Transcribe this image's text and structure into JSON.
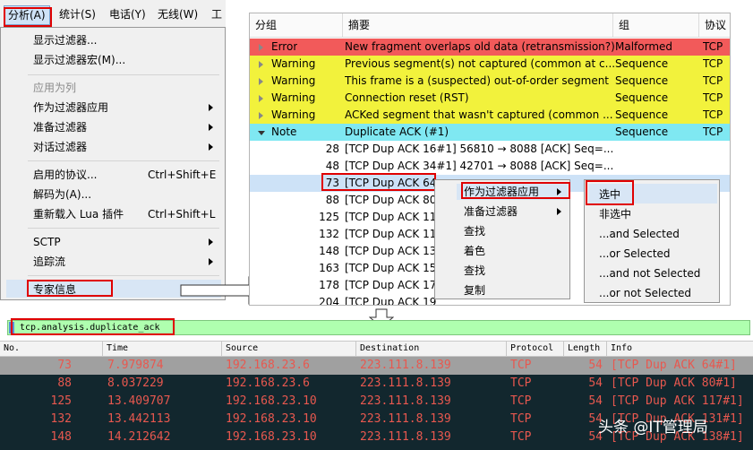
{
  "menubar": {
    "items": [
      "分析(A)",
      "统计(S)",
      "电话(Y)",
      "无线(W)",
      "工"
    ]
  },
  "analyze_menu": {
    "items": [
      {
        "label": "显示过滤器...",
        "shortcut": "",
        "submenu": false,
        "disabled": false
      },
      {
        "label": "显示过滤器宏(M)...",
        "shortcut": "",
        "submenu": false,
        "disabled": false
      },
      {
        "label": "应用为列",
        "shortcut": "",
        "submenu": false,
        "disabled": true
      },
      {
        "label": "作为过滤器应用",
        "shortcut": "",
        "submenu": true,
        "disabled": false
      },
      {
        "label": "准备过滤器",
        "shortcut": "",
        "submenu": true,
        "disabled": false
      },
      {
        "label": "对话过滤器",
        "shortcut": "",
        "submenu": true,
        "disabled": false
      },
      {
        "label": "启用的协议...",
        "shortcut": "Ctrl+Shift+E",
        "submenu": false,
        "disabled": false
      },
      {
        "label": "解码为(A)...",
        "shortcut": "",
        "submenu": false,
        "disabled": false
      },
      {
        "label": "重新载入 Lua 插件",
        "shortcut": "Ctrl+Shift+L",
        "submenu": false,
        "disabled": false
      },
      {
        "label": "SCTP",
        "shortcut": "",
        "submenu": true,
        "disabled": false
      },
      {
        "label": "追踪流",
        "shortcut": "",
        "submenu": true,
        "disabled": false
      },
      {
        "label": "专家信息",
        "shortcut": "",
        "submenu": false,
        "disabled": false
      }
    ]
  },
  "expert_info": {
    "headers": [
      "分组",
      "摘要",
      "组",
      "协议"
    ],
    "entries": [
      {
        "severity": "Error",
        "summary": "New fragment overlaps old data (retransmission?)",
        "group": "Malformed",
        "protocol": "TCP",
        "color": "#f25a5a"
      },
      {
        "severity": "Warning",
        "summary": "Previous segment(s) not captured (common at c...",
        "group": "Sequence",
        "protocol": "TCP",
        "color": "#f2f23c"
      },
      {
        "severity": "Warning",
        "summary": "This frame is a (suspected) out-of-order segment",
        "group": "Sequence",
        "protocol": "TCP",
        "color": "#f2f23c"
      },
      {
        "severity": "Warning",
        "summary": "Connection reset (RST)",
        "group": "Sequence",
        "protocol": "TCP",
        "color": "#f2f23c"
      },
      {
        "severity": "Warning",
        "summary": "ACKed segment that wasn't captured (common ...",
        "group": "Sequence",
        "protocol": "TCP",
        "color": "#f2f23c"
      },
      {
        "severity": "Note",
        "summary": "Duplicate ACK (#1)",
        "group": "Sequence",
        "protocol": "TCP",
        "color": "#7fe8f2"
      }
    ],
    "packets": [
      {
        "no": "28",
        "info": "[TCP Dup ACK 16#1] 56810 → 8088 [ACK] Seq=..."
      },
      {
        "no": "48",
        "info": "[TCP Dup ACK 34#1] 42701 → 8088 [ACK] Seq=..."
      },
      {
        "no": "73",
        "info": "[TCP Dup ACK 64"
      },
      {
        "no": "88",
        "info": "[TCP Dup ACK 80"
      },
      {
        "no": "125",
        "info": "[TCP Dup ACK 11"
      },
      {
        "no": "132",
        "info": "[TCP Dup ACK 11"
      },
      {
        "no": "148",
        "info": "[TCP Dup ACK 13"
      },
      {
        "no": "163",
        "info": "[TCP Dup ACK 15"
      },
      {
        "no": "178",
        "info": "[TCP Dup ACK 17"
      },
      {
        "no": "204",
        "info": "[TCP Dup ACK 19"
      }
    ]
  },
  "context_menu": {
    "items": [
      "作为过滤器应用",
      "准备过滤器",
      "查找",
      "着色",
      "查找",
      "复制"
    ]
  },
  "submenu": {
    "items": [
      "选中",
      "非选中",
      "...and Selected",
      "...or Selected",
      "...and not Selected",
      "...or not Selected"
    ]
  },
  "filter": {
    "text": "tcp.analysis.duplicate_ack",
    "color": "#afffaf"
  },
  "packet_list": {
    "headers": [
      "No.",
      "Time",
      "Source",
      "Destination",
      "Protocol",
      "Length",
      "Info"
    ],
    "rows": [
      {
        "no": "73",
        "time": "7.979874",
        "src": "192.168.23.6",
        "dst": "223.111.8.139",
        "proto": "TCP",
        "len": "54",
        "info": "[TCP Dup ACK 64#1]"
      },
      {
        "no": "88",
        "time": "8.037229",
        "src": "192.168.23.6",
        "dst": "223.111.8.139",
        "proto": "TCP",
        "len": "54",
        "info": "[TCP Dup ACK 80#1]"
      },
      {
        "no": "125",
        "time": "13.409707",
        "src": "192.168.23.10",
        "dst": "223.111.8.139",
        "proto": "TCP",
        "len": "54",
        "info": "[TCP Dup ACK 117#1]"
      },
      {
        "no": "132",
        "time": "13.442113",
        "src": "192.168.23.10",
        "dst": "223.111.8.139",
        "proto": "TCP",
        "len": "54",
        "info": "[TCP Dup ACK 131#1]"
      },
      {
        "no": "148",
        "time": "14.212642",
        "src": "192.168.23.10",
        "dst": "223.111.8.139",
        "proto": "TCP",
        "len": "54",
        "info": "[TCP Dup ACK 138#1]"
      }
    ]
  },
  "watermark": "头条 @IT管理局",
  "colors": {
    "dup_ack_text": "#e8584f",
    "selected_row_bg": "#a0a0a0",
    "packet_bg": "#12272e"
  }
}
